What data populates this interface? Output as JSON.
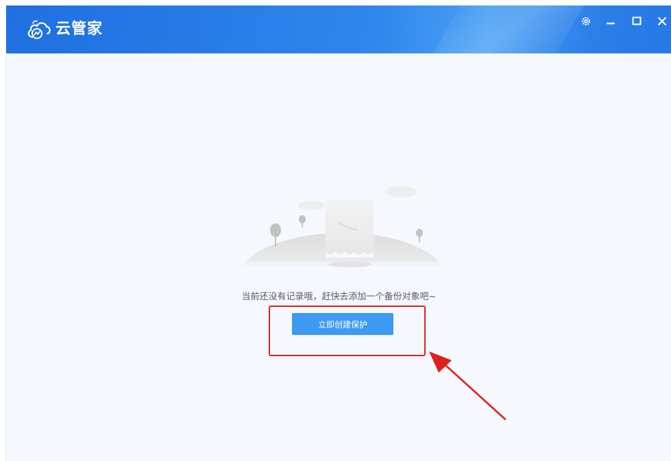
{
  "app": {
    "title": "云管家"
  },
  "window_controls": {
    "settings_icon": "settings-icon",
    "minimize_icon": "minimize-icon",
    "maximize_icon": "maximize-icon",
    "close_icon": "close-icon"
  },
  "main": {
    "empty_message": "当前还没有记录哦，赶快去添加一个备份对象吧~",
    "create_button_label": "立即创建保护"
  },
  "colors": {
    "titlebar": "#2b7fe8",
    "content_background": "#f5f8fd",
    "primary_button": "#3d9af2",
    "annotation": "#e0201c"
  }
}
